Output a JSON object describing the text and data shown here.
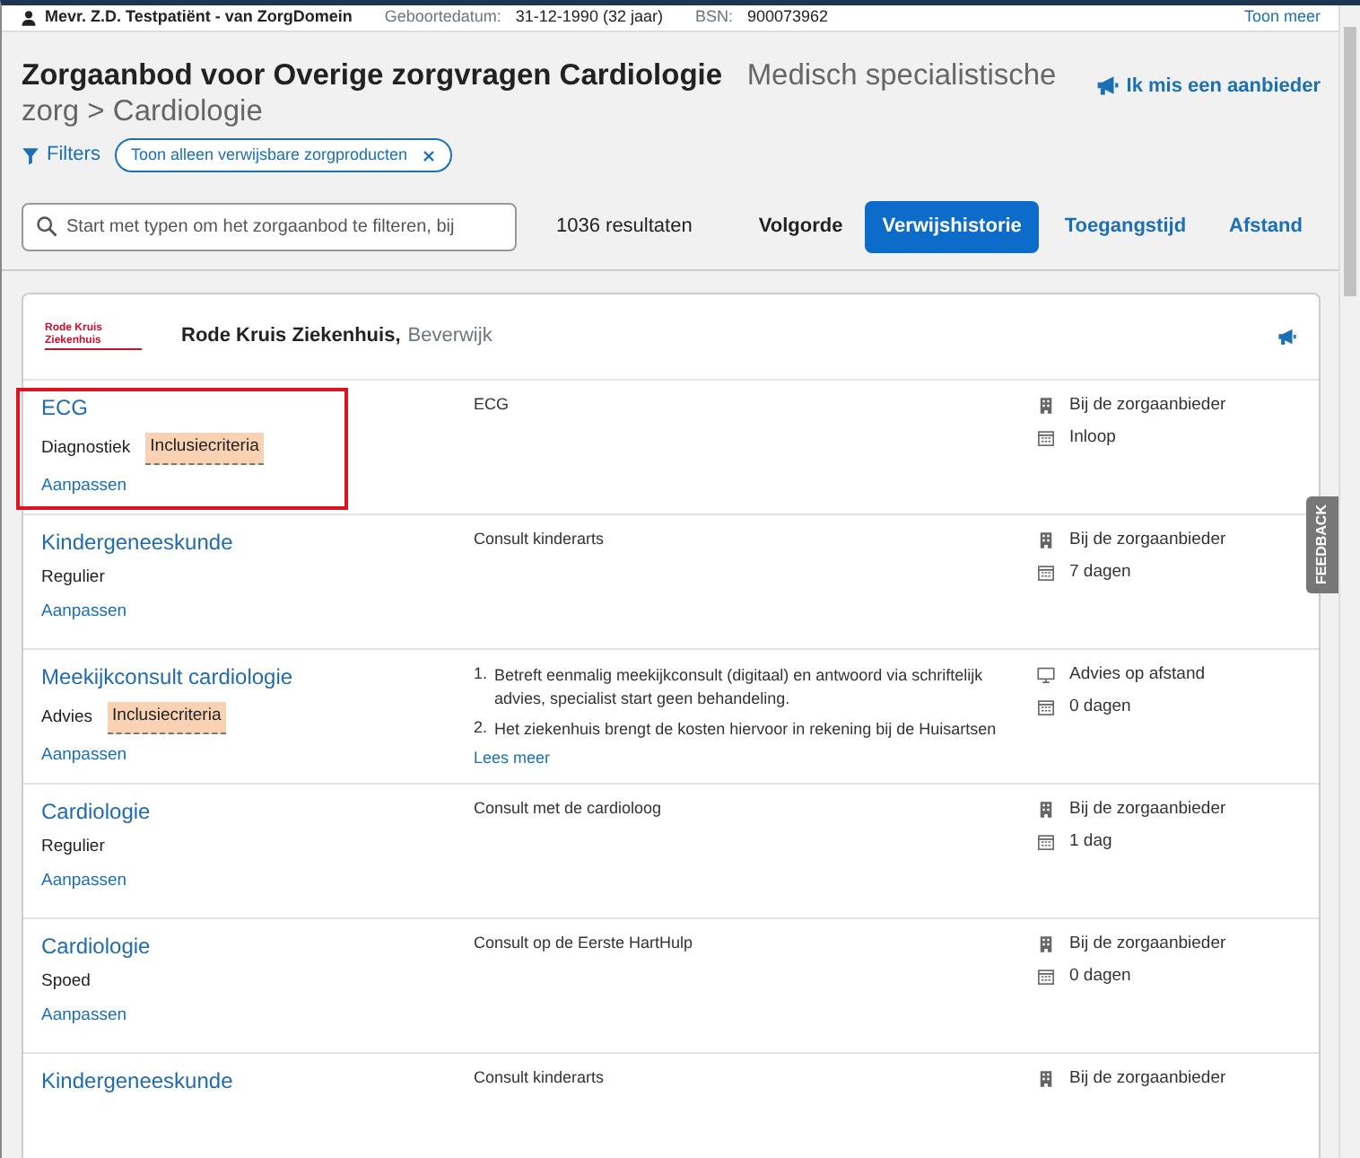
{
  "patient_bar": {
    "name": "Mevr. Z.D. Testpatiënt - van ZorgDomein",
    "birthdate_label": "Geboortedatum:",
    "birthdate": "31-12-1990 (32 jaar)",
    "bsn_label": "BSN:",
    "bsn": "900073962",
    "more_link": "Toon meer"
  },
  "header": {
    "heading": "**Zorgaanbod voor Overige zorgvragen Cardiologie**   Medisch specialistische zorg > Cardiologie",
    "missing_provider_link": "Ik mis een aanbieder"
  },
  "filters": {
    "label": "Filters",
    "chips": [
      {
        "label": "Toon alleen verwijsbare zorgproducten"
      }
    ]
  },
  "search": {
    "placeholder": "Start met typen om het zorgaanbod te filteren, bij"
  },
  "result_count": "1036 resultaten",
  "sort": {
    "label": "Volgorde",
    "options": [
      {
        "label": "Verwijshistorie",
        "selected": true
      },
      {
        "label": "Toegangstijd",
        "selected": false
      },
      {
        "label": "Afstand",
        "selected": false
      }
    ]
  },
  "provider": {
    "logo_text": "Rode Kruis Ziekenhuis",
    "name": "Rode Kruis Ziekenhuis,",
    "city": "Beverwijk"
  },
  "offers": [
    {
      "title": "ECG",
      "type": "Diagnostiek",
      "tag": "Inclusiecriteria",
      "edit_link": "Aanpassen",
      "highlighted": true,
      "description": [
        "ECG"
      ],
      "location": {
        "kind": "building",
        "text": "Bij de zorgaanbieder"
      },
      "wait": "Inloop"
    },
    {
      "title": "Kindergeneeskunde",
      "type": "Regulier",
      "edit_link": "Aanpassen",
      "highlighted": false,
      "description": [
        "Consult kinderarts"
      ],
      "location": {
        "kind": "building",
        "text": "Bij de zorgaanbieder"
      },
      "wait": "7 dagen"
    },
    {
      "title": "Meekijkconsult cardiologie",
      "type": "Advies",
      "tag": "Inclusiecriteria",
      "edit_link": "Aanpassen",
      "highlighted": false,
      "numbered_description": [
        "Betreft eenmalig meekijkconsult (digitaal) en antwoord via schriftelijk advies, specialist start geen behandeling.",
        "Het ziekenhuis brengt de kosten hiervoor in rekening bij de Huisartsen"
      ],
      "markers": [
        "1.",
        "2."
      ],
      "more_link": "Lees meer",
      "location": {
        "kind": "monitor",
        "text": "Advies op afstand"
      },
      "wait": "0 dagen"
    },
    {
      "title": "Cardiologie",
      "type": "Regulier",
      "edit_link": "Aanpassen",
      "highlighted": false,
      "description": [
        "Consult met de cardioloog"
      ],
      "location": {
        "kind": "building",
        "text": "Bij de zorgaanbieder"
      },
      "wait": "1 dag"
    },
    {
      "title": "Cardiologie",
      "type": "Spoed",
      "edit_link": "Aanpassen",
      "highlighted": false,
      "description": [
        "Consult op de Eerste HartHulp"
      ],
      "location": {
        "kind": "building",
        "text": "Bij de zorgaanbieder"
      },
      "wait": "0 dagen"
    },
    {
      "title": "Kindergeneeskunde",
      "highlighted": false,
      "description": [
        "Consult kinderarts"
      ],
      "location": {
        "kind": "building",
        "text": "Bij de zorgaanbieder"
      }
    }
  ],
  "feedback_tab": "FEEDBACK"
}
